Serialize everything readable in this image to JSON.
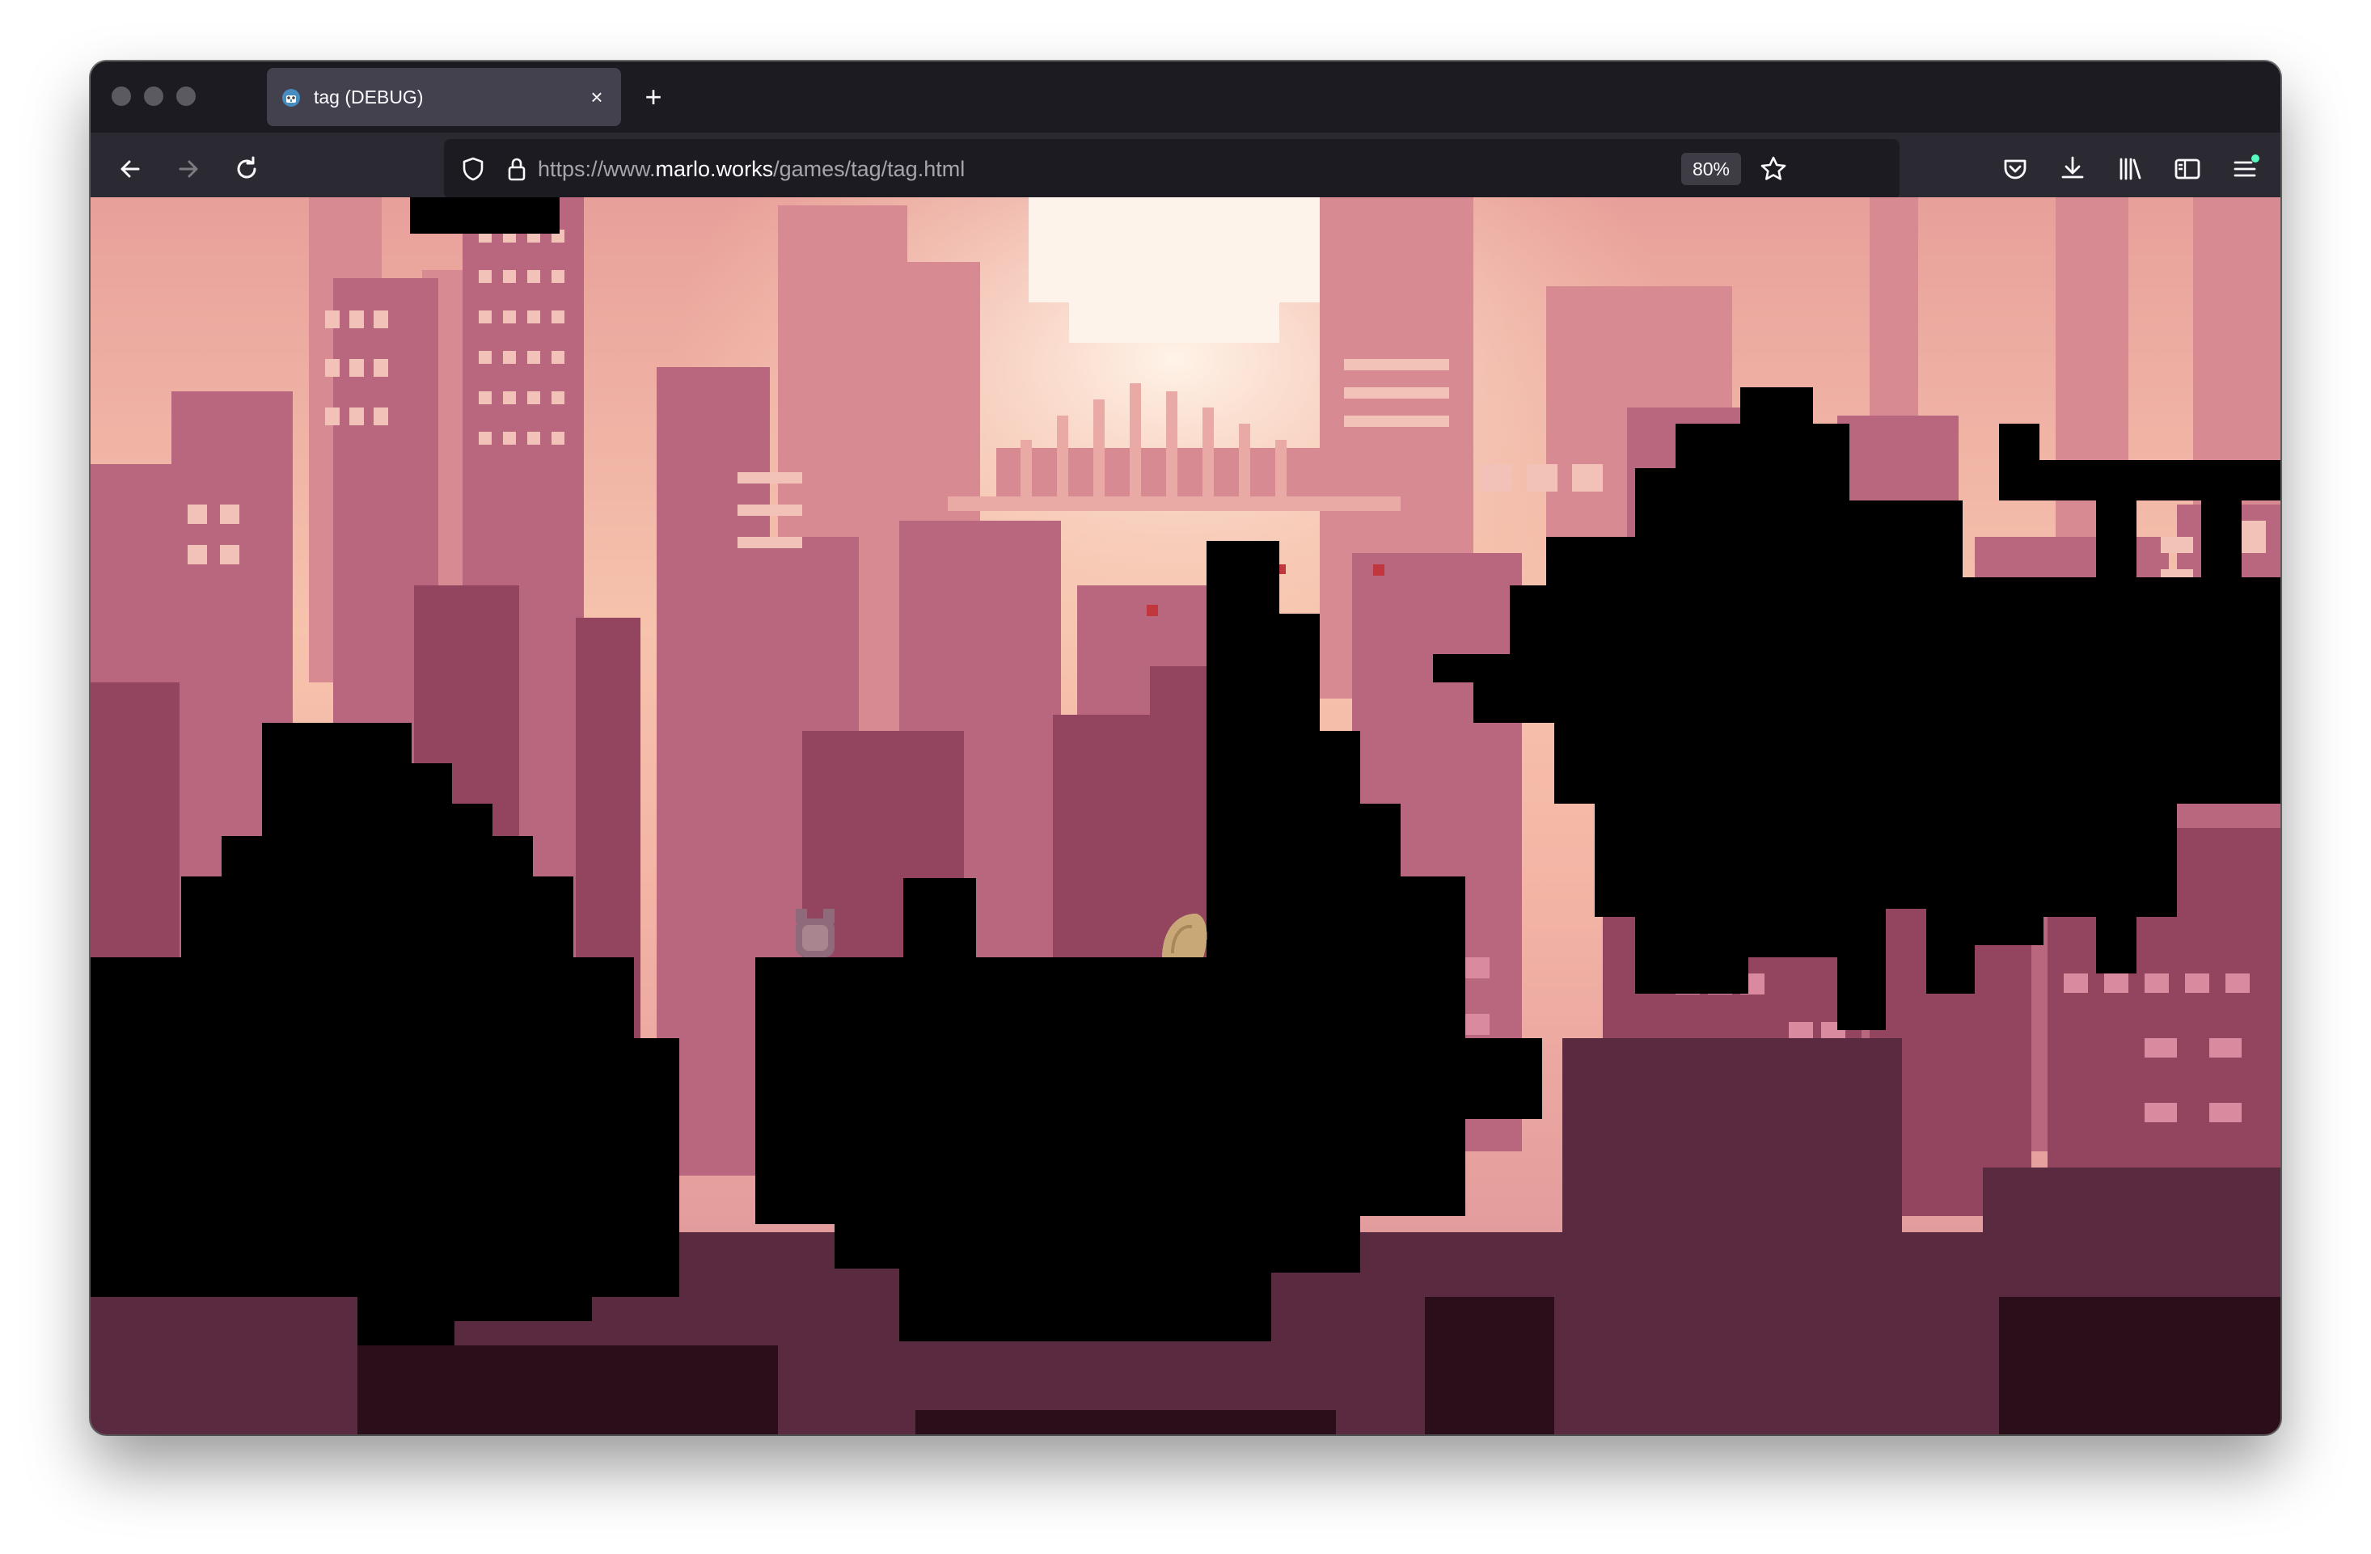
{
  "browser": {
    "tab": {
      "title": "tag (DEBUG)",
      "favicon": "godot-icon",
      "close_label": "×"
    },
    "new_tab_label": "+",
    "url": {
      "prefix": "https://www.",
      "host": "marlo.works",
      "path": "/games/tag/tag.html"
    },
    "zoom": "80%",
    "nav_icons": [
      "back-icon",
      "forward-icon",
      "reload-icon"
    ],
    "url_icons": [
      "shield-icon",
      "lock-icon"
    ],
    "toolbar_icons": [
      "bookmark-star-icon",
      "pocket-icon",
      "downloads-icon",
      "library-icon",
      "sidebar-icon",
      "menu-icon"
    ],
    "colors": {
      "chrome_dark": "#1c1b22",
      "toolbar": "#2b2a33",
      "tab_active": "#42414d",
      "update_dot": "#54ffbd"
    }
  },
  "game": {
    "title": "tag",
    "scene": "pixel-art city skyline at sunset with black silhouette terrain",
    "players": [
      {
        "name": "player-grey-cat",
        "color": "#8e6a7a"
      },
      {
        "name": "player-tan-blob",
        "color": "#c9a877"
      }
    ],
    "palette": {
      "sky_top": "#e8a09a",
      "sky_glow": "#fbd3b8",
      "sun": "#fdf3ea",
      "far_buildings": "#d4828e",
      "mid_buildings": "#b8607a",
      "near_buildings": "#8c405e",
      "foreground": "#4a2032",
      "terrain": "#000000"
    }
  }
}
